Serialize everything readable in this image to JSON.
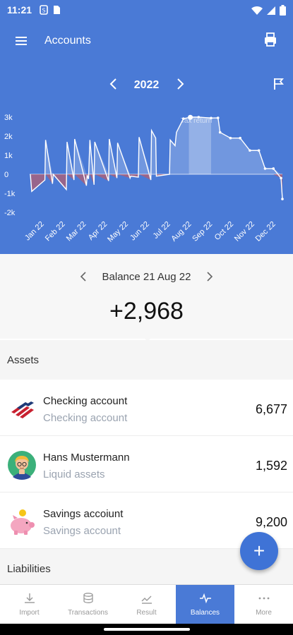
{
  "status_bar": {
    "time": "11:21"
  },
  "app_bar": {
    "title": "Accounts"
  },
  "chart_nav": {
    "year": "2022"
  },
  "chart_data": {
    "type": "area",
    "annotation": "Tax return",
    "categories": [
      "Jan 22",
      "Feb 22",
      "Mar 22",
      "Apr 22",
      "May 22",
      "Jun 22",
      "Jul 22",
      "Aug 22",
      "Sep 22",
      "Oct 22",
      "Nov 22",
      "Dec 22"
    ],
    "y_ticks": [
      "3k",
      "2k",
      "1k",
      "0",
      "-1k",
      "-2k"
    ],
    "ylim": [
      -2000,
      3000
    ],
    "series": [
      {
        "x": [
          1,
          3,
          22,
          23,
          33,
          34,
          53,
          54,
          64,
          65,
          82,
          83,
          85,
          87,
          93,
          94,
          114,
          115,
          126,
          127,
          145,
          146,
          157,
          158,
          175,
          176,
          182,
          183,
          202,
          203,
          210,
          212,
          222,
          232,
          234,
          244,
          262,
          272,
          275,
          290,
          304,
          318,
          331,
          340,
          352,
          363,
          365
        ],
        "y": [
          0,
          -900,
          -300,
          1800,
          -500,
          0,
          -800,
          1700,
          -300,
          1850,
          -600,
          -50,
          -250,
          1800,
          -550,
          1700,
          -350,
          1850,
          -200,
          1650,
          -200,
          -100,
          -150,
          1950,
          -300,
          2300,
          1900,
          -100,
          0,
          1800,
          1500,
          2200,
          2920,
          2990,
          3000,
          3000,
          2950,
          2960,
          2200,
          1900,
          1900,
          1250,
          1250,
          300,
          300,
          -200,
          -1300
        ]
      }
    ]
  },
  "balance": {
    "label": "Balance 21 Aug 22",
    "value": "+2,968"
  },
  "assets": {
    "header": "Assets",
    "items": [
      {
        "name": "Checking account",
        "sub": "Checking account",
        "amount": "6,677"
      },
      {
        "name": "Hans Mustermann",
        "sub": "Liquid assets",
        "amount": "1,592"
      },
      {
        "name": "Savings accoiunt",
        "sub": "Savings account",
        "amount": "9,200"
      }
    ]
  },
  "liabilities": {
    "header": "Liabilities"
  },
  "fab": {
    "label": "+"
  },
  "nav": {
    "tabs": [
      {
        "label": "Import",
        "icon": "download-icon"
      },
      {
        "label": "Transactions",
        "icon": "stack-icon"
      },
      {
        "label": "Result",
        "icon": "trend-icon"
      },
      {
        "label": "Balances",
        "icon": "pulse-icon",
        "active": true
      },
      {
        "label": "More",
        "icon": "more-icon"
      }
    ]
  },
  "colors": {
    "primary": "#4a7ad6",
    "negative": "#d9534f"
  }
}
